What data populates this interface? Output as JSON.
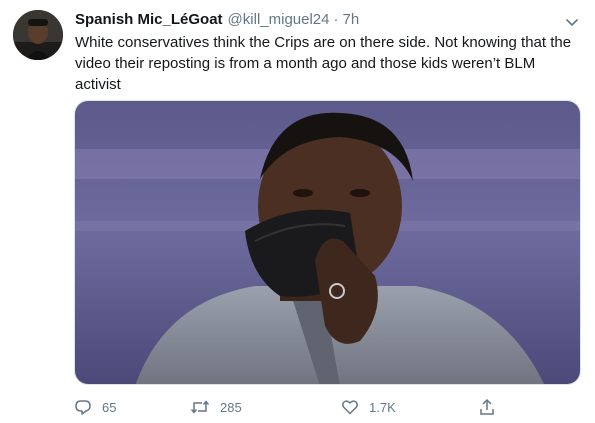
{
  "tweet": {
    "display_name": "Spanish Mic_LéGoat",
    "handle": "@kill_miguel24",
    "separator": "·",
    "time": "7h",
    "text": "White conservatives think the Crips are on there side. Not knowing that the video their reposting is from a month ago and those kids weren’t BLM activist",
    "media_alt": "Man in grey suit holding a black face mask over his mouth"
  },
  "actions": {
    "replies": "65",
    "retweets": "285",
    "likes": "1.7K"
  },
  "icons": {
    "reply": "reply-icon",
    "retweet": "retweet-icon",
    "like": "heart-icon",
    "share": "share-icon",
    "more": "chevron-down-icon"
  },
  "colors": {
    "text": "#14171a",
    "secondary": "#657786",
    "border": "#dfe3e6"
  }
}
